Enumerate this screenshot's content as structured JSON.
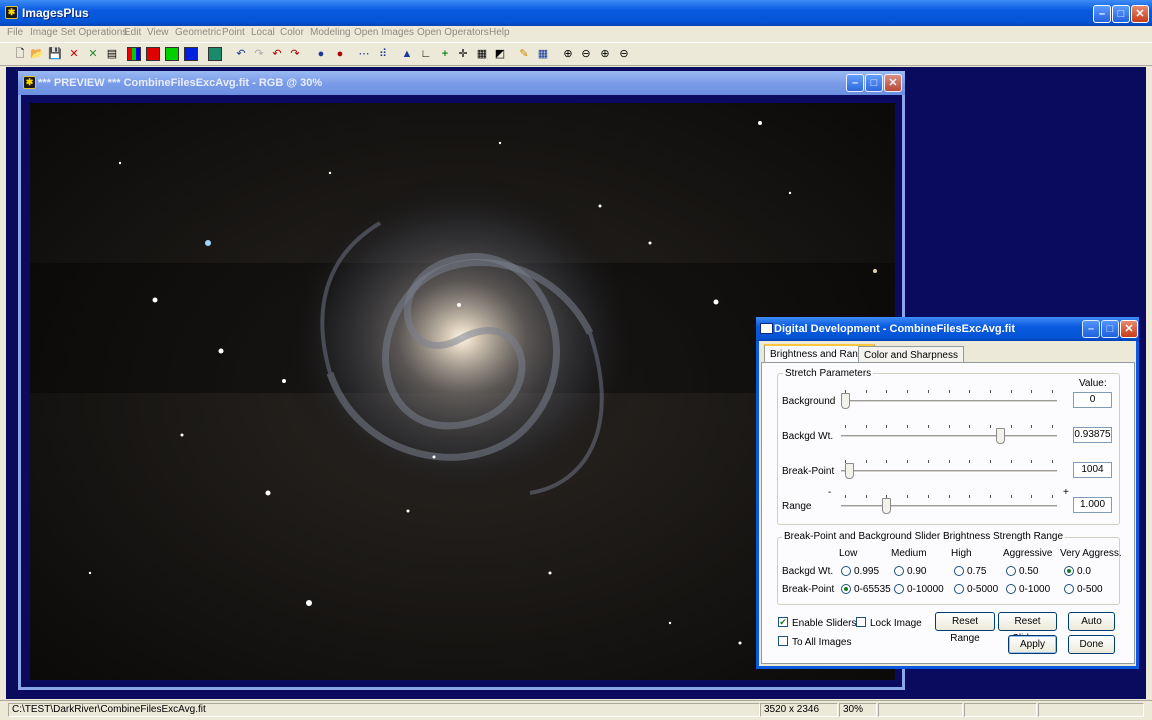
{
  "app": {
    "title": "ImagesPlus",
    "menu": [
      "File",
      "Image Set Operations",
      "Edit",
      "View",
      "Geometric",
      "Point",
      "Local",
      "Color",
      "Modeling",
      "Open Images",
      "Open Operators",
      "Help"
    ]
  },
  "preview": {
    "title": "*** PREVIEW *** CombineFilesExcAvg.fit - RGB @ 30%"
  },
  "dialog": {
    "title": "Digital Development - CombineFilesExcAvg.fit",
    "tabs": [
      "Brightness and Range",
      "Color and Sharpness"
    ],
    "stretch": {
      "group_label": "Stretch Parameters",
      "value_header": "Value:",
      "rows": [
        {
          "label": "Background",
          "value": "0",
          "slider_fraction": 0.0
        },
        {
          "label": "Backgd Wt.",
          "value": "0.93875",
          "slider_fraction": 0.75
        },
        {
          "label": "Break-Point",
          "value": "1004",
          "slider_fraction": 0.02
        },
        {
          "label": "Range",
          "value": "1.000",
          "slider_fraction": 0.2,
          "min_mark": "-",
          "max_mark": "+"
        }
      ]
    },
    "strength": {
      "group_label": "Break-Point and Background Slider Brightness Strength Range",
      "columns": [
        "Low",
        "Medium",
        "High",
        "Aggressive",
        "Very Aggress."
      ],
      "backgd_label": "Backgd Wt.",
      "backgd_options": [
        "0.995",
        "0.90",
        "0.75",
        "0.50",
        "0.0"
      ],
      "backgd_selected": 4,
      "breakpoint_label": "Break-Point",
      "breakpoint_options": [
        "0-65535",
        "0-10000",
        "0-5000",
        "0-1000",
        "0-500"
      ],
      "breakpoint_selected": 0
    },
    "options": {
      "enable_sliders": "Enable Sliders",
      "enable_sliders_checked": true,
      "lock_image": "Lock Image",
      "lock_image_checked": false,
      "to_all_images": "To All Images",
      "to_all_images_checked": false
    },
    "buttons": {
      "reset_range": "Reset Range",
      "reset_sliders": "Reset Sliders",
      "auto": "Auto",
      "apply": "Apply",
      "done": "Done"
    }
  },
  "status": {
    "path": "C:\\TEST\\DarkRiver\\CombineFilesExcAvg.fit",
    "dimensions": "3520 x 2346",
    "zoom": "30%"
  },
  "icons": [
    "app-icon",
    "minimize-icon",
    "maximize-icon",
    "close-icon",
    "new-file-icon",
    "open-folder-icon",
    "save-icon",
    "undo-icon",
    "redo-icon",
    "zoom-in-icon",
    "zoom-out-icon",
    "pencil-icon",
    "grid-icon"
  ],
  "colors": {
    "titlebar": "#0a5ae0",
    "workspace": "#0a0a5e",
    "face": "#ECE9D8"
  }
}
